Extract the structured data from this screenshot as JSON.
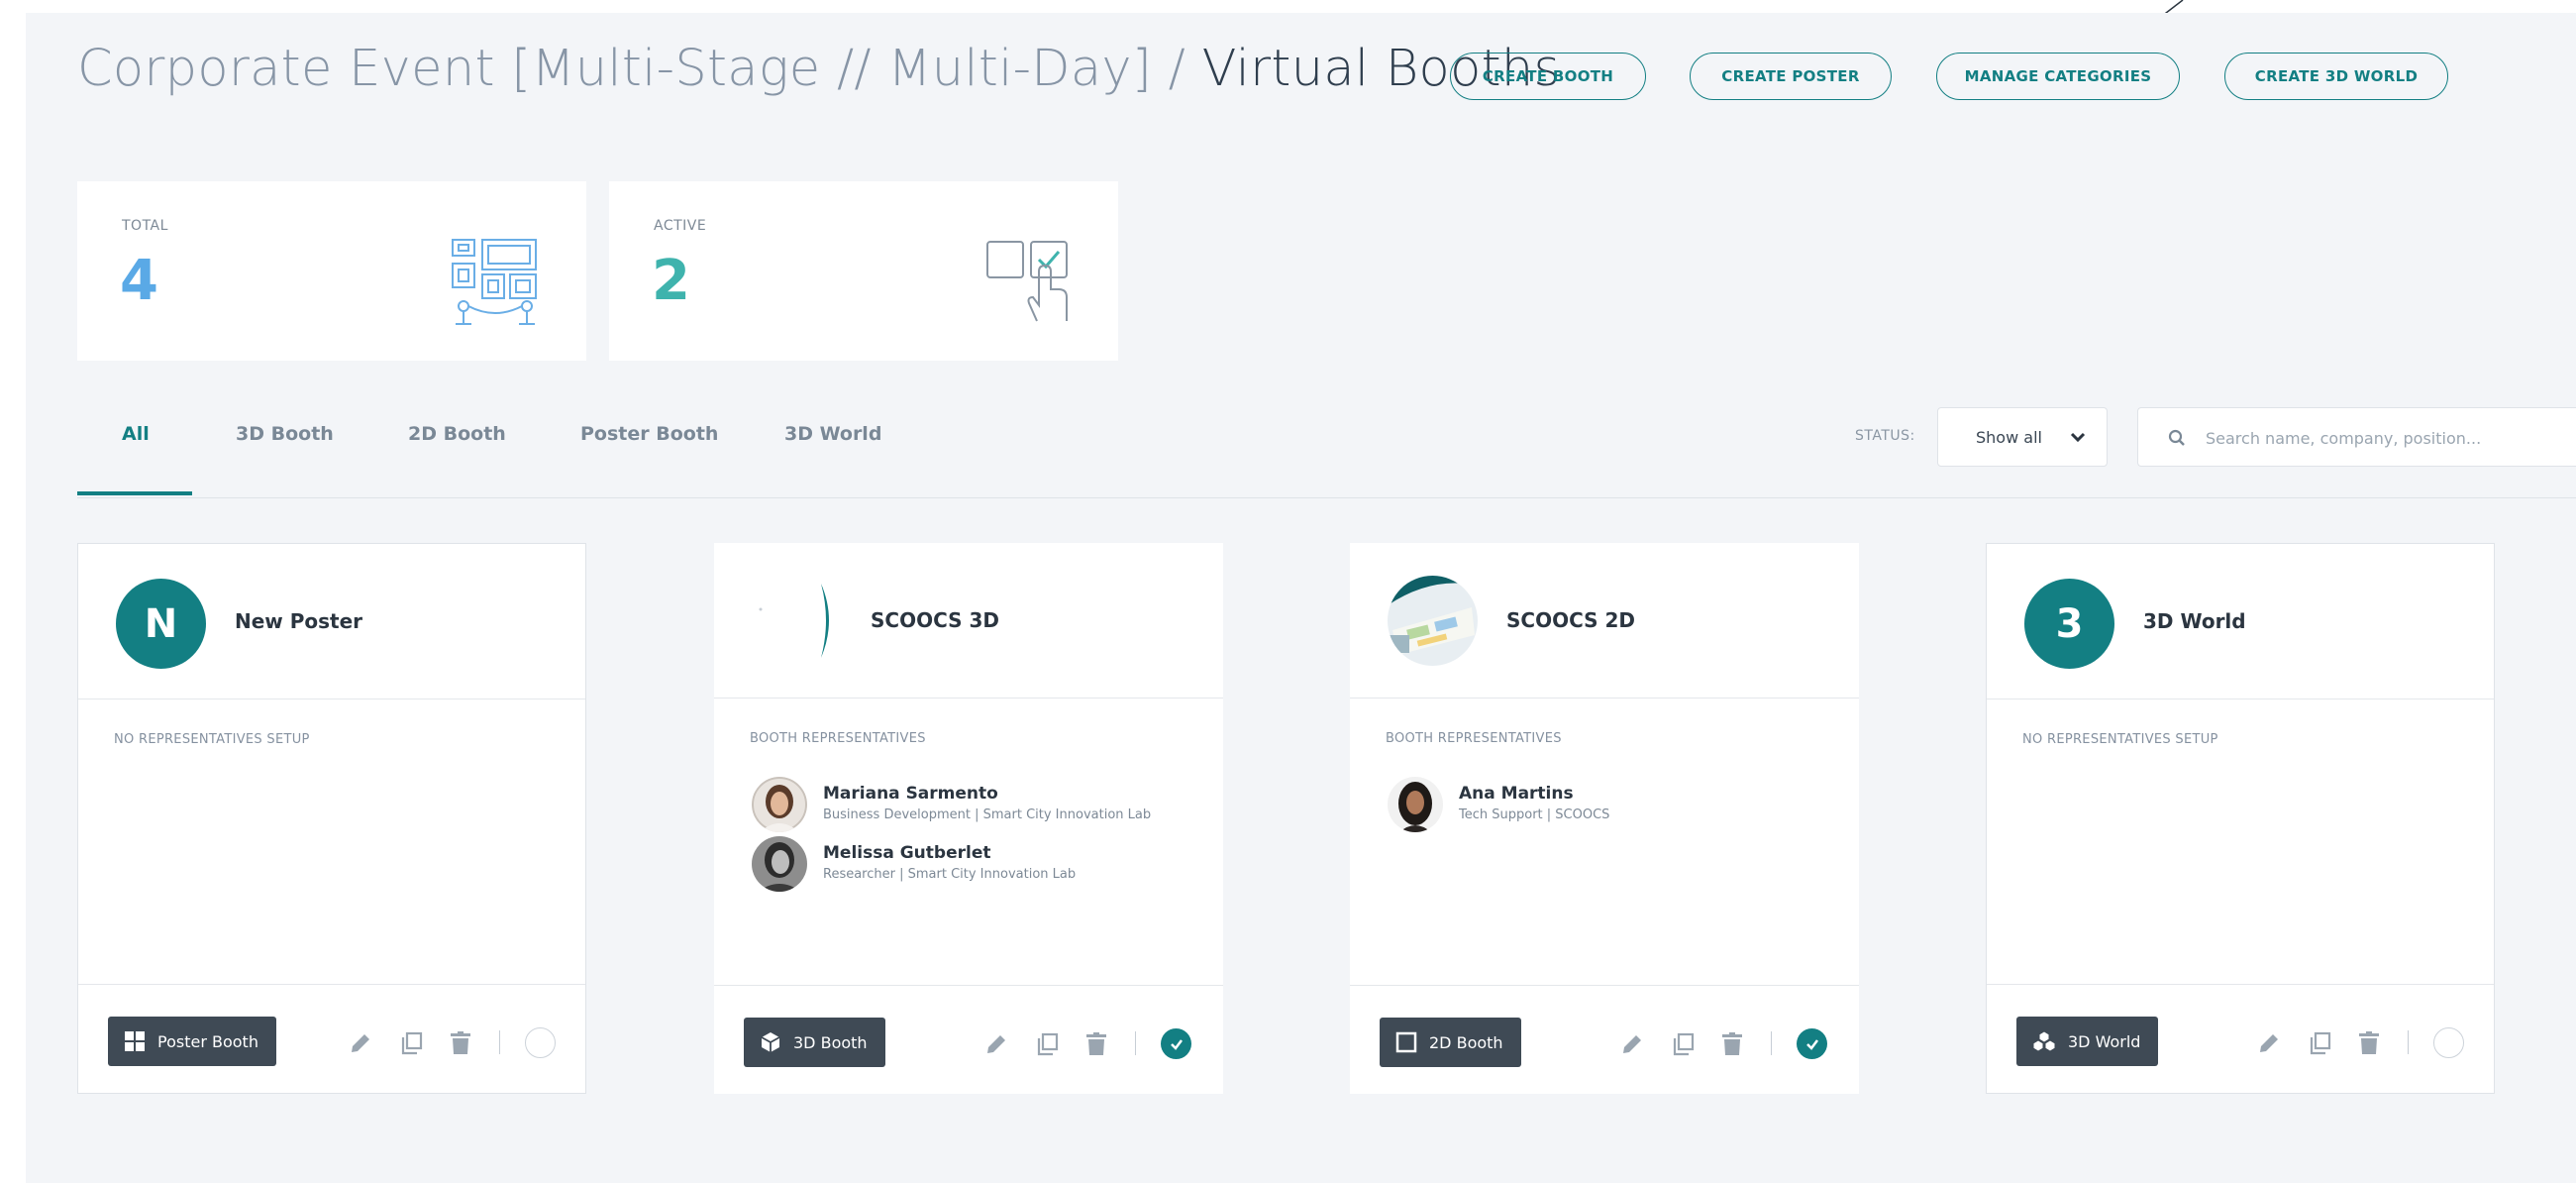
{
  "header": {
    "breadcrumb_event": "Corporate Event [Multi-Stage // Multi-Day] /",
    "breadcrumb_current": "Virtual Booths",
    "buttons": {
      "create_booth": "CREATE BOOTH",
      "create_poster": "CREATE POSTER",
      "manage_categories": "MANAGE CATEGORIES",
      "create_3d_world": "CREATE 3D WORLD"
    }
  },
  "stats": {
    "total": {
      "label": "TOTAL",
      "value": "4",
      "color": "#5aa9e6",
      "icon": "booth-grid-icon"
    },
    "active": {
      "label": "ACTIVE",
      "value": "2",
      "color": "#3fb3ad",
      "icon": "touch-check-icon"
    }
  },
  "tabs": [
    "All",
    "3D Booth",
    "2D Booth",
    "Poster Booth",
    "3D World"
  ],
  "active_tab": "All",
  "filters": {
    "status_label": "STATUS:",
    "status_value": "Show all",
    "search_placeholder": "Search name, company, position..."
  },
  "booths": [
    {
      "initial": "N",
      "name": "New Poster",
      "section_label": "NO REPRESENTATIVES SETUP",
      "representatives": [],
      "type_label": "Poster Booth",
      "type_icon": "grid-icon",
      "active": false
    },
    {
      "name": "SCOOCS 3D",
      "section_label": "BOOTH REPRESENTATIVES",
      "representatives": [
        {
          "name": "Mariana Sarmento",
          "meta": "Business Development  |  Smart City Innovation Lab"
        },
        {
          "name": "Melissa Gutberlet",
          "meta": "Researcher  |  Smart City Innovation Lab"
        }
      ],
      "type_label": "3D Booth",
      "type_icon": "cube-icon",
      "active": true
    },
    {
      "name": "SCOOCS 2D",
      "section_label": "BOOTH REPRESENTATIVES",
      "representatives": [
        {
          "name": "Ana Martins",
          "meta": "Tech Support  |  SCOOCS"
        }
      ],
      "type_label": "2D Booth",
      "type_icon": "square-icon",
      "active": true
    },
    {
      "initial": "3",
      "name": "3D World",
      "section_label": "NO REPRESENTATIVES SETUP",
      "representatives": [],
      "type_label": "3D World",
      "type_icon": "cubes-icon",
      "active": false
    }
  ],
  "colors": {
    "accent": "#137f83",
    "badge": "#3f4a55",
    "background": "#f3f5f8"
  }
}
